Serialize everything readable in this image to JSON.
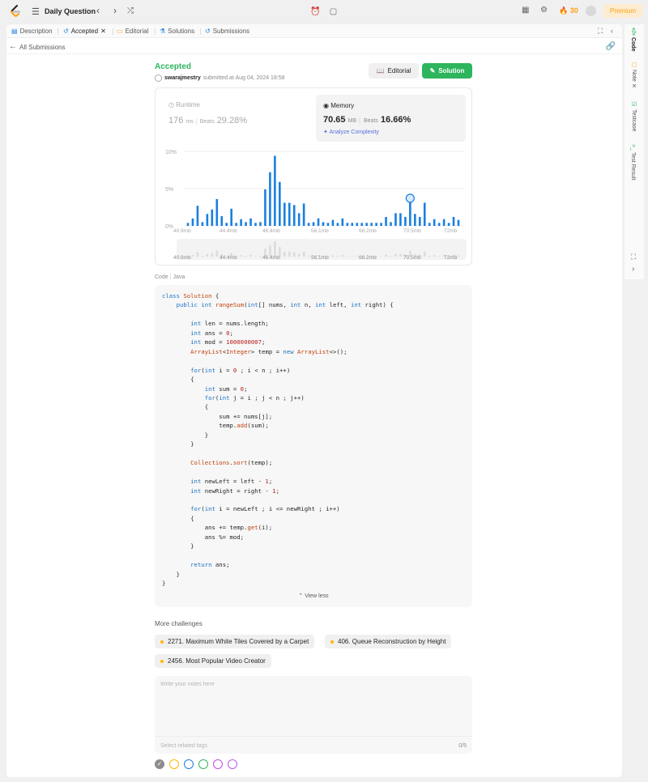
{
  "topbar": {
    "title": "Daily Question",
    "streak": "30",
    "premium": "Premium"
  },
  "tabs": [
    {
      "label": "Description"
    },
    {
      "label": "Accepted"
    },
    {
      "label": "Editorial"
    },
    {
      "label": "Solutions"
    },
    {
      "label": "Submissions"
    }
  ],
  "back": {
    "label": "All Submissions"
  },
  "submission": {
    "status": "Accepted",
    "user": "swarajmestry",
    "submitted_text": "submitted at Aug 04, 2024 18:58",
    "editorial_btn": "Editorial",
    "solution_btn": "Solution"
  },
  "runtime": {
    "label": "Runtime",
    "value": "176",
    "unit": "ms",
    "beats_label": "Beats",
    "beats": "29.28%"
  },
  "memory": {
    "label": "Memory",
    "value": "70.65",
    "unit": "MB",
    "beats_label": "Beats",
    "beats": "16.66%",
    "analyze": "Analyze Complexity"
  },
  "chart_data": {
    "type": "bar",
    "ylabel_ticks": [
      "10%",
      "5%",
      "0%"
    ],
    "ylim": [
      0,
      10
    ],
    "grid": true,
    "x_tick_labels": [
      "40.9mb",
      "44.4mb",
      "46.4mb",
      "56.1mb",
      "68.2mb",
      "70.5mb",
      "72mb"
    ],
    "values": [
      0.4,
      1.0,
      2.7,
      0.5,
      1.6,
      2.2,
      3.6,
      1.3,
      0.4,
      2.3,
      0.4,
      0.9,
      0.5,
      1.0,
      0.4,
      0.5,
      4.9,
      7.2,
      9.4,
      5.9,
      3.1,
      3.1,
      2.8,
      1.7,
      3.0,
      0.4,
      0.5,
      1.0,
      0.5,
      0.4,
      0.8,
      0.4,
      1.0,
      0.4,
      0.4,
      0.4,
      0.4,
      0.4,
      0.4,
      0.4,
      0.4,
      1.2,
      0.5,
      1.7,
      1.7,
      1.2,
      3.6,
      1.6,
      1.2,
      3.1,
      0.4,
      0.9,
      0.4,
      0.9,
      0.4,
      1.2,
      0.8
    ],
    "highlight_index": 46,
    "color": "#1a7fe0"
  },
  "code": {
    "label": "Code",
    "lang": "Java",
    "view_less": "View less"
  },
  "more": {
    "title": "More challenges",
    "items": [
      "2271. Maximum White Tiles Covered by a Carpet",
      "406. Queue Reconstruction by Height",
      "2456. Most Popular Video Creator"
    ]
  },
  "notes": {
    "placeholder": "Write your notes here",
    "tags_placeholder": "Select related tags",
    "count": "0/5"
  },
  "colors": [
    "#8c8c8c",
    "#ffb800",
    "#1a7fe0",
    "#2db55d",
    "#c04de0",
    "#b05de0"
  ],
  "side_tabs": [
    "Code",
    "Note",
    "Testcase",
    "Test Result"
  ]
}
